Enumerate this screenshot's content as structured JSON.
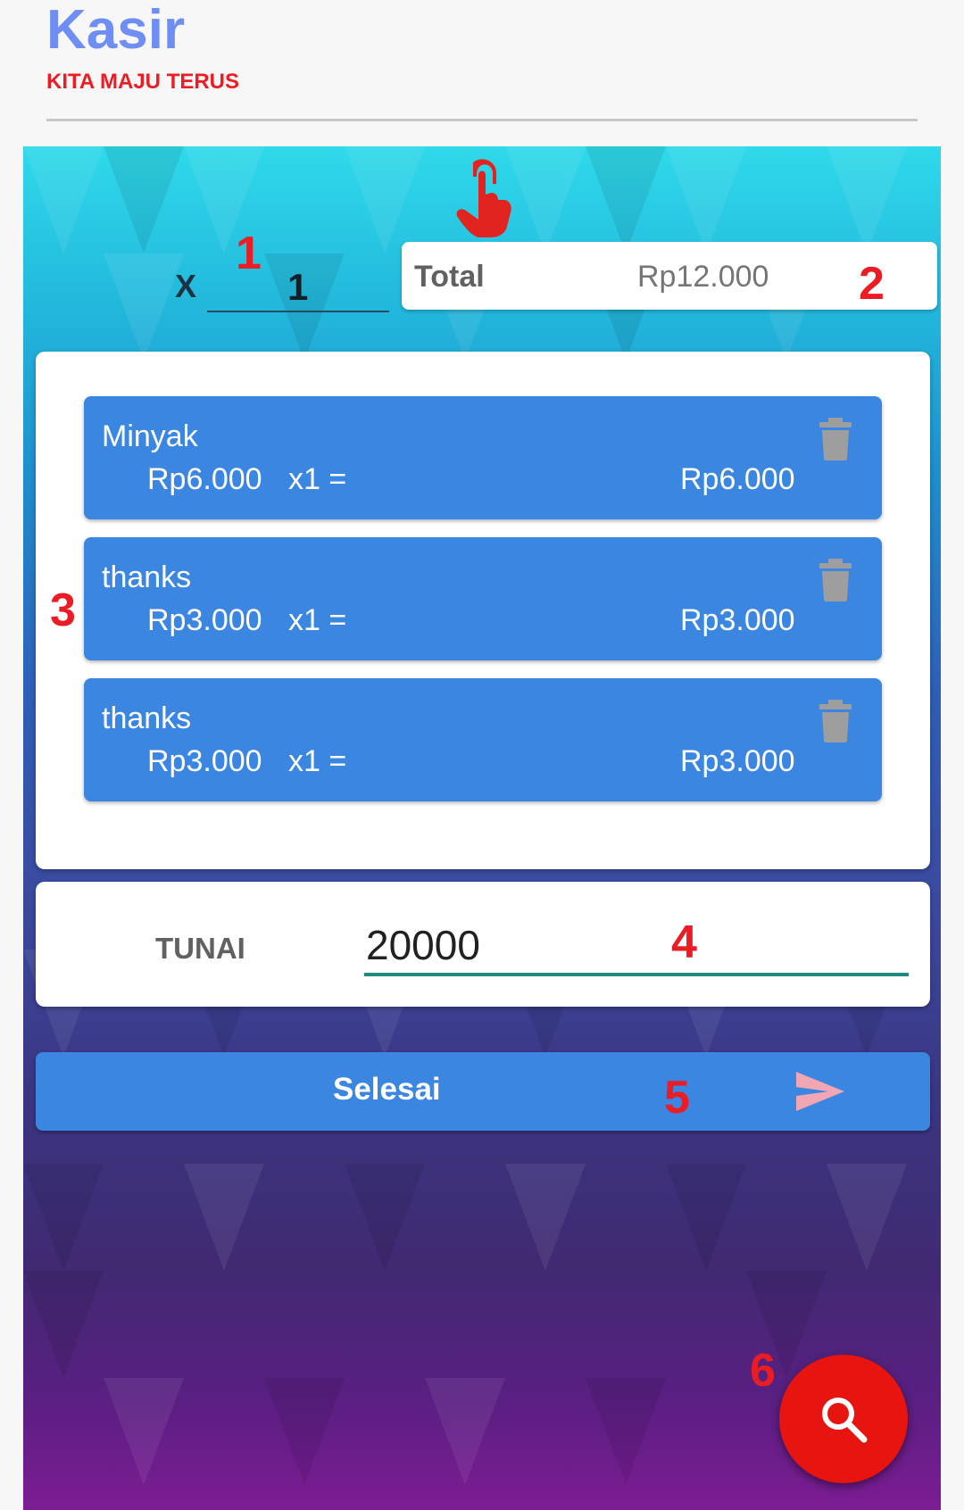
{
  "header": {
    "title": "Kasir",
    "subtitle": "KITA MAJU TERUS"
  },
  "quantity": {
    "prefix": "X",
    "value": "1"
  },
  "total": {
    "label": "Total",
    "value": "Rp12.000"
  },
  "cart": {
    "items": [
      {
        "name": "Minyak",
        "price": "Rp6.000",
        "qty": "x1 =",
        "subtotal": "Rp6.000",
        "delete_icon": "trash-icon"
      },
      {
        "name": "thanks",
        "price": "Rp3.000",
        "qty": "x1 =",
        "subtotal": "Rp3.000",
        "delete_icon": "trash-icon"
      },
      {
        "name": "thanks",
        "price": "Rp3.000",
        "qty": "x1 =",
        "subtotal": "Rp3.000",
        "delete_icon": "trash-icon"
      }
    ]
  },
  "cash": {
    "label": "TUNAI",
    "value": "20000"
  },
  "finish_button": {
    "label": "Selesai",
    "icon": "send-icon"
  },
  "fab": {
    "icon": "search-icon"
  },
  "hint_icon": "pointing-hand-icon",
  "annotations": [
    "1",
    "2",
    "3",
    "4",
    "5",
    "6"
  ],
  "colors": {
    "title": "#6f8ef5",
    "subtitle": "#ec1c24",
    "item_card": "#3a86e0",
    "button": "#3a86e0",
    "fab": "#e8140f",
    "input_underline": "#1f8a7e",
    "annotation": "#ec1c24"
  }
}
